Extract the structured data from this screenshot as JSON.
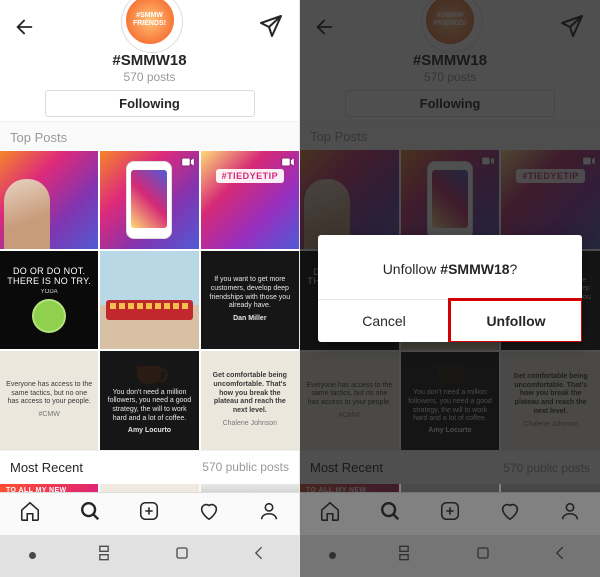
{
  "header": {
    "badge": "#SMMW FRIENDS!",
    "hashtag": "#SMMW18",
    "post_count": "570 posts",
    "follow_button": "Following"
  },
  "sections": {
    "top": "Top Posts",
    "recent": "Most Recent",
    "recent_count": "570 public posts"
  },
  "tiles": {
    "t3_tag": "#TIEDYETIP",
    "t4_line": "DO OR DO NOT. THERE IS NO TRY.",
    "t4_attr": "YODA",
    "t6": "If you want to get more customers, develop deep friendships with those you already have.",
    "t6_attr": "Dan Miller",
    "t7": "Everyone has access to the same tactics, but no one has access to your people.",
    "t7_hash": "#CMW",
    "t8": "You don't need a million followers, you need a good strategy, the will to work hard and a lot of coffee.",
    "t8_attr": "Amy Locurto",
    "t9": "Get comfortable being uncomfortable. That's how you break the plateau and reach the next level.",
    "t9_attr": "Chalene Johnson"
  },
  "peek_banner": "TO ALL MY NEW",
  "dialog": {
    "msg_pre": "Unfollow ",
    "msg_bold": "#SMMW18",
    "msg_post": "?",
    "cancel": "Cancel",
    "unfollow": "Unfollow"
  },
  "icons": {
    "back": "back-arrow-icon",
    "send": "paper-plane-icon",
    "video": "video-icon",
    "home": "home-icon",
    "search": "search-icon",
    "add": "add-post-icon",
    "heart": "heart-icon",
    "profile": "profile-icon",
    "nav_recent": "recents-icon",
    "nav_home": "android-home-icon",
    "nav_back": "android-back-icon"
  }
}
